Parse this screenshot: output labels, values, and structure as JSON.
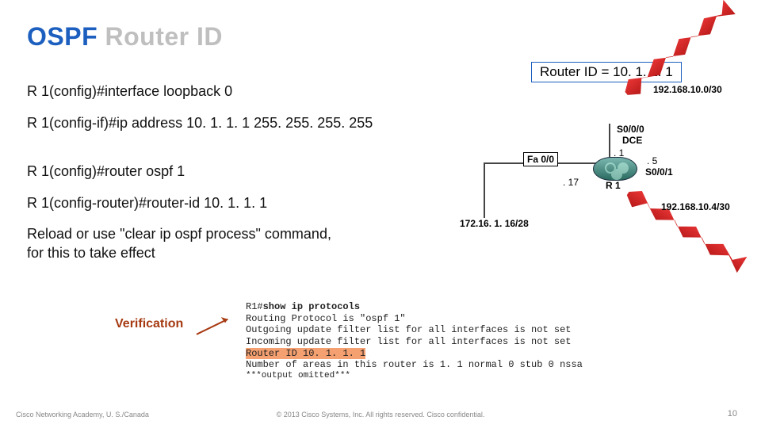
{
  "title": {
    "w1": "OSPF",
    "w2": "Router",
    "w3": "ID"
  },
  "router_id_label": "Router ID = 10. 1. 1. 1",
  "commands": {
    "l1": "R 1(config)#interface loopback 0",
    "l2": "R 1(config-if)#ip address 10. 1. 1. 1 255. 255. 255. 255",
    "l3": "R 1(config)#router ospf 1",
    "l4": "R 1(config-router)#router-id 10. 1. 1. 1",
    "l5a": "Reload or use \"clear ip ospf process\" command,",
    "l5b": "for this to take effect"
  },
  "verification_label": "Verification",
  "diagram": {
    "net1": "192.168.10.0/30",
    "s000": "S0/0/0",
    "dce": "DCE",
    "fa0": "Fa 0/0",
    "dot1": ". 1",
    "dot5": ". 5",
    "dot17": ". 17",
    "r1": "R 1",
    "s001": "S0/0/1",
    "net2": "172.16. 1. 16/28",
    "net3": "192.168.10.4/30"
  },
  "terminal": {
    "t1a": "R1#",
    "t1b": "show ip protocols",
    "t2": "Routing Protocol is \"ospf 1\"",
    "t3": "  Outgoing update filter list for all interfaces is not set",
    "t4": "  Incoming update filter list for all interfaces is not set",
    "t5": "  Router ID 10. 1. 1. 1",
    "t6": "  Number of areas in this router is 1. 1 normal 0 stub 0 nssa",
    "t7": "***output omitted***"
  },
  "footer": {
    "left": "Cisco Networking Academy, U. S./Canada",
    "center": "© 2013 Cisco Systems, Inc. All rights reserved.  Cisco confidential.",
    "right": "10"
  }
}
